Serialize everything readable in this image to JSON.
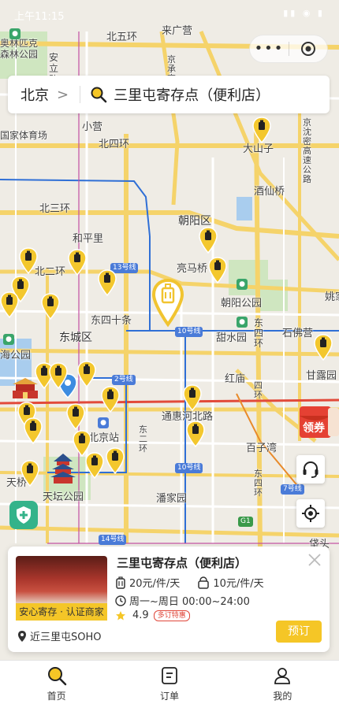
{
  "status": {
    "time": "上午11:15",
    "icons": "▮▮ ◉ ▮"
  },
  "capsule": {
    "more_icon": "more-dots-icon",
    "target_icon": "target-icon",
    "more_label": "•••"
  },
  "search": {
    "city": "北京",
    "chevron": ">",
    "query": "三里屯寄存点（便利店）"
  },
  "map_labels": {
    "beiwuhuan": "北五环",
    "laiguangying": "来广营",
    "olympic": "奥林匹克森林公园",
    "anli": "安立路",
    "jingcheng": "京承高速",
    "xiaoying": "小营",
    "national": "国家体育场",
    "beisihuan": "北四环",
    "dashanzi": "大山子",
    "jingmi": "京沈密高速公路",
    "jiuxianqiao": "酒仙桥",
    "beisanhuan": "北三环",
    "chaoyangqu": "朝阳区",
    "hepingli": "和平里",
    "beierhuan": "北二环",
    "liangmaqiao": "亮马桥",
    "chaoyanggongyuan": "朝阳公园",
    "yaojia": "姚家",
    "dongsishitiao": "东四十条",
    "dongchengqu": "东城区",
    "tianshuiyuan": "甜水园",
    "dongsi": "东四环",
    "shifoying": "石佛营",
    "haigongyuan": "海公园",
    "ganlu": "甘露园",
    "honmiao": "红庙",
    "sihuan": "四环",
    "tonghuihe": "通惠河北路",
    "beijingzhan": "北京站",
    "baiziwan": "百子湾",
    "dongerhuan": "东二环",
    "tianqiao": "天桥",
    "tiantan": "天坛公园",
    "panjiayuan": "潘家园",
    "dongsihuan2": "东四环",
    "xiaotou": "垡头",
    "line13": "13号线",
    "line10a": "10号线",
    "line2": "2号线",
    "line10b": "10号线",
    "line7": "7号线",
    "line14": "14号线",
    "g1": "G1"
  },
  "side_buttons": {
    "service_icon": "headset-icon",
    "locate_icon": "locate-icon"
  },
  "coupon": {
    "label": "领券"
  },
  "card": {
    "title": "三里屯寄存点（便利店）",
    "photo_badge": "安心寄存 · 认证商家",
    "price_large": "20元/件/天",
    "price_small": "10元/件/天",
    "hours": "周一~周日 00:00~24:00",
    "rating": "4.9",
    "rating_tag": "多订特惠",
    "location": "近三里屯SOHO",
    "book_label": "预订",
    "accent": "#f5c626"
  },
  "tabs": [
    {
      "label": "首页",
      "icon": "search-icon"
    },
    {
      "label": "订单",
      "icon": "order-icon"
    },
    {
      "label": "我的",
      "icon": "person-icon"
    }
  ]
}
